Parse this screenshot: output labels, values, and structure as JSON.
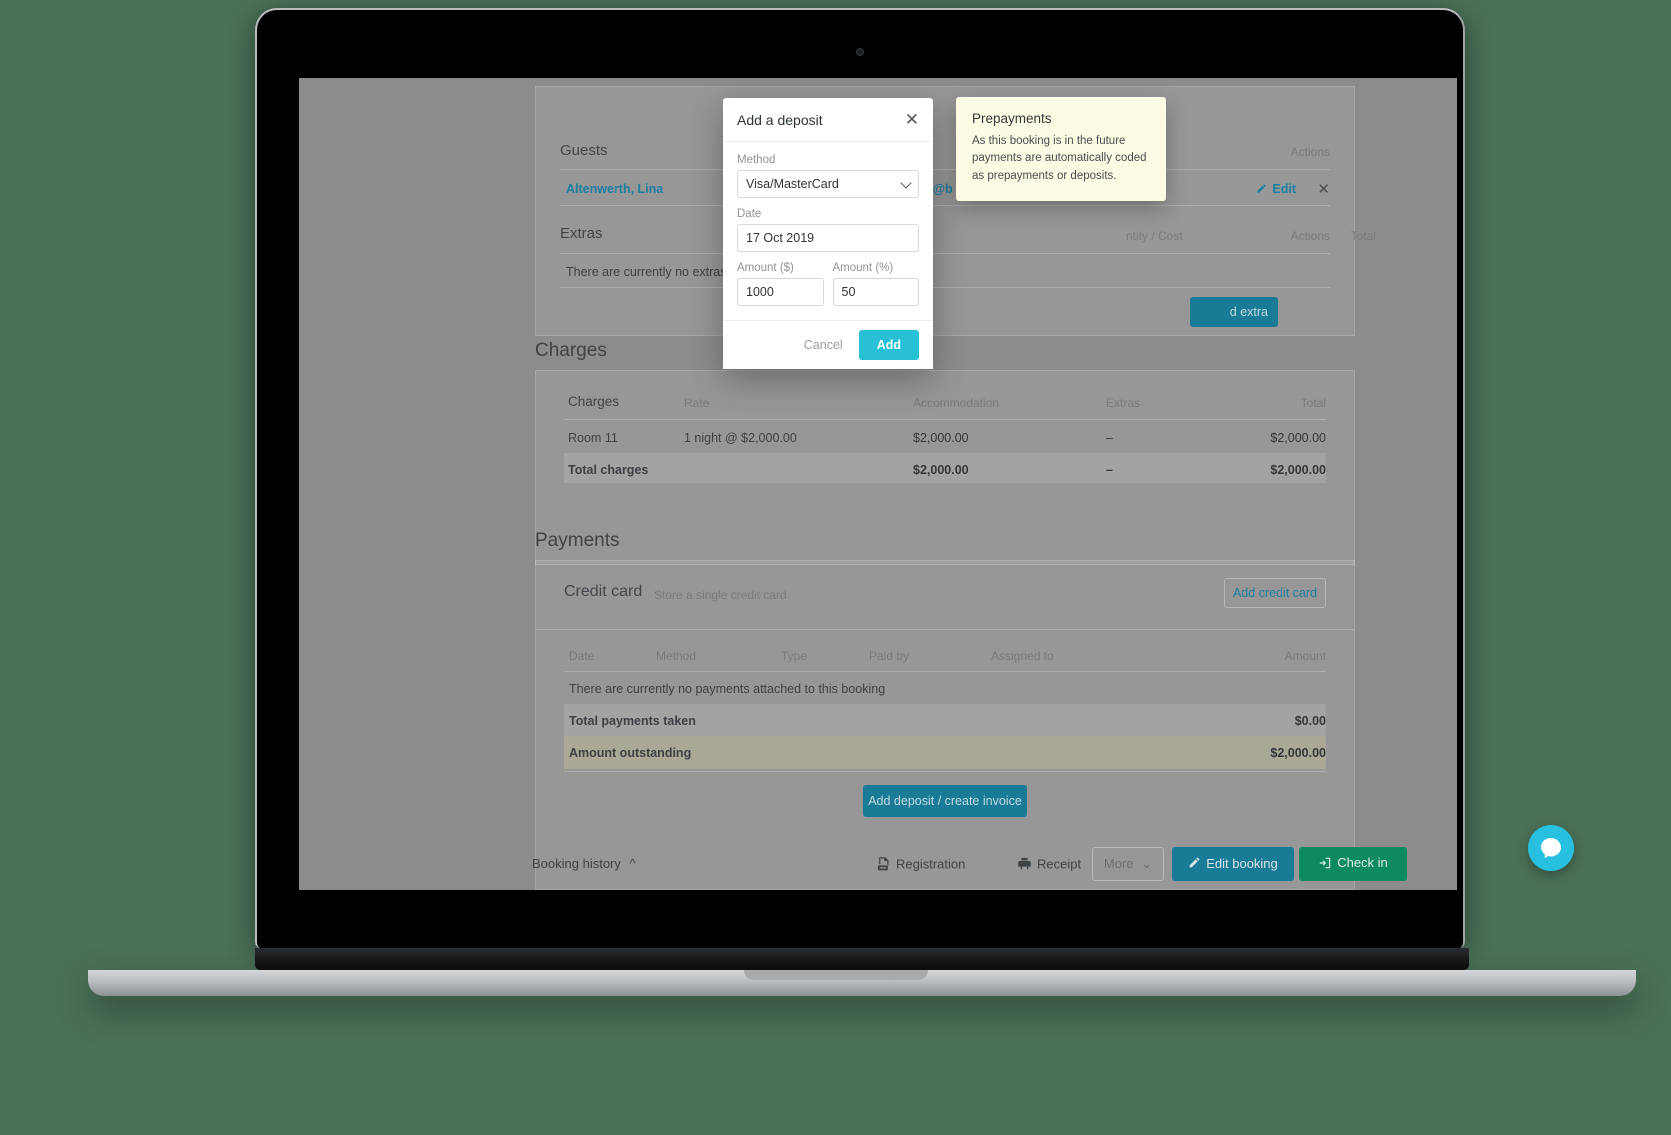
{
  "modal": {
    "title": "Add a deposit",
    "close_icon": "close-icon",
    "fields": {
      "method_label": "Method",
      "method_value": "Visa/MasterCard",
      "date_label": "Date",
      "date_value": "17 Oct 2019",
      "amount_dollar_label": "Amount ($)",
      "amount_dollar_value": "1000",
      "amount_percent_label": "Amount (%)",
      "amount_percent_value": "50"
    },
    "cancel_label": "Cancel",
    "add_label": "Add"
  },
  "tooltip": {
    "title": "Prepayments",
    "body": "As this booking is in the future payments are automatically coded as prepayments or deposits."
  },
  "guests": {
    "heading": "Guests",
    "actions_header": "Actions",
    "rows": [
      {
        "name": "Altenwerth, Lina",
        "email": "th@b",
        "edit_label": "Edit",
        "remove_icon": "close-icon"
      }
    ]
  },
  "extras": {
    "heading": "Extras",
    "col_quantity_cost": "ntity / Cost",
    "col_total": "Total",
    "col_actions": "Actions",
    "empty_message": "There are currently no extras att",
    "add_button_label": "d extra"
  },
  "charges": {
    "section_title": "Charges",
    "columns": [
      "Charges",
      "Rate",
      "Accommodation",
      "Extras",
      "Total"
    ],
    "rows": [
      {
        "charge": "Room 11",
        "rate": "1 night @ $2,000.00",
        "accommodation": "$2,000.00",
        "extras": "–",
        "total": "$2,000.00"
      }
    ],
    "total_row": {
      "label": "Total charges",
      "rate": "",
      "accommodation": "$2,000.00",
      "extras": "–",
      "total": "$2,000.00"
    }
  },
  "payments": {
    "section_title": "Payments",
    "credit_card_title": "Credit card",
    "credit_card_subtitle": "Store a single credit card",
    "add_credit_card_label": "Add credit card",
    "columns": [
      "Date",
      "Method",
      "Type",
      "Paid by",
      "Assigned to",
      "Amount"
    ],
    "empty_message": "There are currently no payments attached to this booking",
    "total_payments_label": "Total payments taken",
    "total_payments_value": "$0.00",
    "amount_outstanding_label": "Amount outstanding",
    "amount_outstanding_value": "$2,000.00",
    "add_deposit_button_label": "Add deposit / create invoice"
  },
  "action_bar": {
    "booking_history_label": "Booking history",
    "booking_history_caret": "^",
    "registration_label": "Registration",
    "receipt_label": "Receipt",
    "more_label": "More",
    "more_caret": "⌄",
    "edit_booking_label": "Edit booking",
    "check_in_label": "Check in"
  },
  "colors": {
    "accent_teal": "#1a7b96",
    "accent_cyan": "#27c0d4",
    "accent_green": "#0e8a63",
    "link_blue": "#1a7fa0",
    "tooltip_bg": "#fcfbe4",
    "olive_row": "#bab896",
    "page_backdrop": "#8c8c8c",
    "desktop_green": "#4a7057"
  }
}
